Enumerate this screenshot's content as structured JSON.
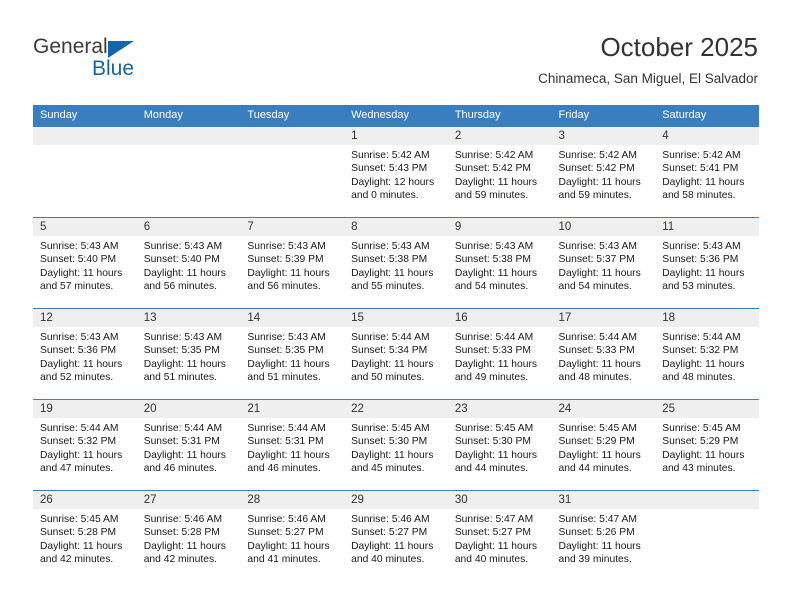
{
  "brand": {
    "name_top": "General",
    "name_bottom": "Blue",
    "accent_color": "#1565a8"
  },
  "header": {
    "title": "October 2025",
    "subtitle": "Chinameca, San Miguel, El Salvador"
  },
  "calendar": {
    "header_bg_color": "#3a7ebf",
    "daynum_band_color": "#efefef",
    "weekday_headers": [
      "Sunday",
      "Monday",
      "Tuesday",
      "Wednesday",
      "Thursday",
      "Friday",
      "Saturday"
    ],
    "weeks": [
      [
        {
          "day": "",
          "empty": true
        },
        {
          "day": "",
          "empty": true
        },
        {
          "day": "",
          "empty": true
        },
        {
          "day": "1",
          "sunrise": "Sunrise: 5:42 AM",
          "sunset": "Sunset: 5:43 PM",
          "daylight_line1": "Daylight: 12 hours",
          "daylight_line2": "and 0 minutes."
        },
        {
          "day": "2",
          "sunrise": "Sunrise: 5:42 AM",
          "sunset": "Sunset: 5:42 PM",
          "daylight_line1": "Daylight: 11 hours",
          "daylight_line2": "and 59 minutes."
        },
        {
          "day": "3",
          "sunrise": "Sunrise: 5:42 AM",
          "sunset": "Sunset: 5:42 PM",
          "daylight_line1": "Daylight: 11 hours",
          "daylight_line2": "and 59 minutes."
        },
        {
          "day": "4",
          "sunrise": "Sunrise: 5:42 AM",
          "sunset": "Sunset: 5:41 PM",
          "daylight_line1": "Daylight: 11 hours",
          "daylight_line2": "and 58 minutes."
        }
      ],
      [
        {
          "day": "5",
          "sunrise": "Sunrise: 5:43 AM",
          "sunset": "Sunset: 5:40 PM",
          "daylight_line1": "Daylight: 11 hours",
          "daylight_line2": "and 57 minutes."
        },
        {
          "day": "6",
          "sunrise": "Sunrise: 5:43 AM",
          "sunset": "Sunset: 5:40 PM",
          "daylight_line1": "Daylight: 11 hours",
          "daylight_line2": "and 56 minutes."
        },
        {
          "day": "7",
          "sunrise": "Sunrise: 5:43 AM",
          "sunset": "Sunset: 5:39 PM",
          "daylight_line1": "Daylight: 11 hours",
          "daylight_line2": "and 56 minutes."
        },
        {
          "day": "8",
          "sunrise": "Sunrise: 5:43 AM",
          "sunset": "Sunset: 5:38 PM",
          "daylight_line1": "Daylight: 11 hours",
          "daylight_line2": "and 55 minutes."
        },
        {
          "day": "9",
          "sunrise": "Sunrise: 5:43 AM",
          "sunset": "Sunset: 5:38 PM",
          "daylight_line1": "Daylight: 11 hours",
          "daylight_line2": "and 54 minutes."
        },
        {
          "day": "10",
          "sunrise": "Sunrise: 5:43 AM",
          "sunset": "Sunset: 5:37 PM",
          "daylight_line1": "Daylight: 11 hours",
          "daylight_line2": "and 54 minutes."
        },
        {
          "day": "11",
          "sunrise": "Sunrise: 5:43 AM",
          "sunset": "Sunset: 5:36 PM",
          "daylight_line1": "Daylight: 11 hours",
          "daylight_line2": "and 53 minutes."
        }
      ],
      [
        {
          "day": "12",
          "sunrise": "Sunrise: 5:43 AM",
          "sunset": "Sunset: 5:36 PM",
          "daylight_line1": "Daylight: 11 hours",
          "daylight_line2": "and 52 minutes."
        },
        {
          "day": "13",
          "sunrise": "Sunrise: 5:43 AM",
          "sunset": "Sunset: 5:35 PM",
          "daylight_line1": "Daylight: 11 hours",
          "daylight_line2": "and 51 minutes."
        },
        {
          "day": "14",
          "sunrise": "Sunrise: 5:43 AM",
          "sunset": "Sunset: 5:35 PM",
          "daylight_line1": "Daylight: 11 hours",
          "daylight_line2": "and 51 minutes."
        },
        {
          "day": "15",
          "sunrise": "Sunrise: 5:44 AM",
          "sunset": "Sunset: 5:34 PM",
          "daylight_line1": "Daylight: 11 hours",
          "daylight_line2": "and 50 minutes."
        },
        {
          "day": "16",
          "sunrise": "Sunrise: 5:44 AM",
          "sunset": "Sunset: 5:33 PM",
          "daylight_line1": "Daylight: 11 hours",
          "daylight_line2": "and 49 minutes."
        },
        {
          "day": "17",
          "sunrise": "Sunrise: 5:44 AM",
          "sunset": "Sunset: 5:33 PM",
          "daylight_line1": "Daylight: 11 hours",
          "daylight_line2": "and 48 minutes."
        },
        {
          "day": "18",
          "sunrise": "Sunrise: 5:44 AM",
          "sunset": "Sunset: 5:32 PM",
          "daylight_line1": "Daylight: 11 hours",
          "daylight_line2": "and 48 minutes."
        }
      ],
      [
        {
          "day": "19",
          "sunrise": "Sunrise: 5:44 AM",
          "sunset": "Sunset: 5:32 PM",
          "daylight_line1": "Daylight: 11 hours",
          "daylight_line2": "and 47 minutes."
        },
        {
          "day": "20",
          "sunrise": "Sunrise: 5:44 AM",
          "sunset": "Sunset: 5:31 PM",
          "daylight_line1": "Daylight: 11 hours",
          "daylight_line2": "and 46 minutes."
        },
        {
          "day": "21",
          "sunrise": "Sunrise: 5:44 AM",
          "sunset": "Sunset: 5:31 PM",
          "daylight_line1": "Daylight: 11 hours",
          "daylight_line2": "and 46 minutes."
        },
        {
          "day": "22",
          "sunrise": "Sunrise: 5:45 AM",
          "sunset": "Sunset: 5:30 PM",
          "daylight_line1": "Daylight: 11 hours",
          "daylight_line2": "and 45 minutes."
        },
        {
          "day": "23",
          "sunrise": "Sunrise: 5:45 AM",
          "sunset": "Sunset: 5:30 PM",
          "daylight_line1": "Daylight: 11 hours",
          "daylight_line2": "and 44 minutes."
        },
        {
          "day": "24",
          "sunrise": "Sunrise: 5:45 AM",
          "sunset": "Sunset: 5:29 PM",
          "daylight_line1": "Daylight: 11 hours",
          "daylight_line2": "and 44 minutes."
        },
        {
          "day": "25",
          "sunrise": "Sunrise: 5:45 AM",
          "sunset": "Sunset: 5:29 PM",
          "daylight_line1": "Daylight: 11 hours",
          "daylight_line2": "and 43 minutes."
        }
      ],
      [
        {
          "day": "26",
          "sunrise": "Sunrise: 5:45 AM",
          "sunset": "Sunset: 5:28 PM",
          "daylight_line1": "Daylight: 11 hours",
          "daylight_line2": "and 42 minutes."
        },
        {
          "day": "27",
          "sunrise": "Sunrise: 5:46 AM",
          "sunset": "Sunset: 5:28 PM",
          "daylight_line1": "Daylight: 11 hours",
          "daylight_line2": "and 42 minutes."
        },
        {
          "day": "28",
          "sunrise": "Sunrise: 5:46 AM",
          "sunset": "Sunset: 5:27 PM",
          "daylight_line1": "Daylight: 11 hours",
          "daylight_line2": "and 41 minutes."
        },
        {
          "day": "29",
          "sunrise": "Sunrise: 5:46 AM",
          "sunset": "Sunset: 5:27 PM",
          "daylight_line1": "Daylight: 11 hours",
          "daylight_line2": "and 40 minutes."
        },
        {
          "day": "30",
          "sunrise": "Sunrise: 5:47 AM",
          "sunset": "Sunset: 5:27 PM",
          "daylight_line1": "Daylight: 11 hours",
          "daylight_line2": "and 40 minutes."
        },
        {
          "day": "31",
          "sunrise": "Sunrise: 5:47 AM",
          "sunset": "Sunset: 5:26 PM",
          "daylight_line1": "Daylight: 11 hours",
          "daylight_line2": "and 39 minutes."
        },
        {
          "day": "",
          "empty": true
        }
      ]
    ]
  }
}
